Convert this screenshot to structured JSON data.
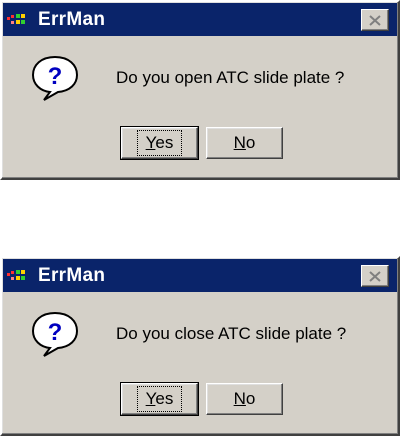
{
  "colors": {
    "titlebar": "#0a246a",
    "dialog_face": "#d4d0c8"
  },
  "dialogs": [
    {
      "title": "ErrMan",
      "message": "Do you open ATC slide plate ?",
      "icon": "question-icon",
      "buttons": {
        "yes": "Yes",
        "no": "No"
      },
      "default_button": "yes"
    },
    {
      "title": "ErrMan",
      "message": "Do you close ATC slide plate ?",
      "icon": "question-icon",
      "buttons": {
        "yes": "Yes",
        "no": "No"
      },
      "default_button": "yes"
    }
  ]
}
